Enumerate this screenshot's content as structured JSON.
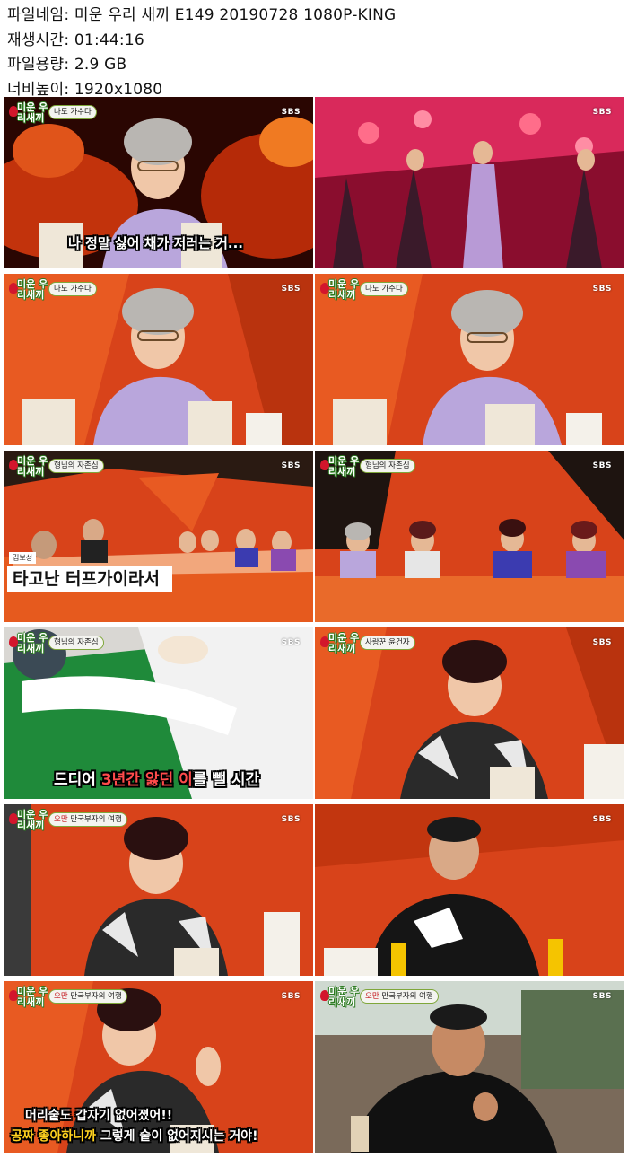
{
  "meta": {
    "filename_label": "파일네임:",
    "filename": "미운 우리 새끼 E149 20190728 1080P-KING",
    "runtime_label": "재생시간:",
    "runtime": "01:44:16",
    "filesize_label": "파일용량:",
    "filesize": "2.9 GB",
    "resolution_label": "너비높이:",
    "resolution": "1920x1080"
  },
  "logo_text": "미운 우리새끼",
  "broadcaster": "SBS",
  "frames": [
    {
      "badge": "나도 가수다",
      "caption": "나 정말 싫어 채가 저러는 거..."
    },
    {
      "badge": "",
      "caption": ""
    },
    {
      "badge": "나도 가수다",
      "caption": ""
    },
    {
      "badge": "나도 가수다",
      "caption": ""
    },
    {
      "badge": "형님의 자존심",
      "caption": "",
      "name_tag": "김보성",
      "big_caption": "타고난 터프가이라서"
    },
    {
      "badge": "형님의 자존심",
      "caption": ""
    },
    {
      "badge": "형님의 자존심",
      "caption_pre": "드디어 ",
      "caption_hl1": "3년간 앓던 이",
      "caption_post": "를 뺄 시간"
    },
    {
      "badge": "사랑꾼 윤건자",
      "caption": ""
    },
    {
      "badge_red": "오만 ",
      "badge": "만국부자의 여행",
      "caption": ""
    },
    {
      "badge": "",
      "caption": ""
    },
    {
      "badge_red": "오만 ",
      "badge": "만국부자의 여행",
      "caption_line1": "머리숱도 갑자기 없어졌어!!",
      "caption_line2_a": "공짜 좋아하니까",
      "caption_line2_b": " 그렇게 숱이 없어지시는 거야!"
    },
    {
      "badge_red": "오만 ",
      "badge": "만국부자의 여행",
      "caption": ""
    }
  ],
  "colors": {
    "studio_orange": "#e0481a",
    "logo_green": "#2a7a1f",
    "caption_yellow": "#ffd21f",
    "caption_red": "#ff4b4b"
  }
}
